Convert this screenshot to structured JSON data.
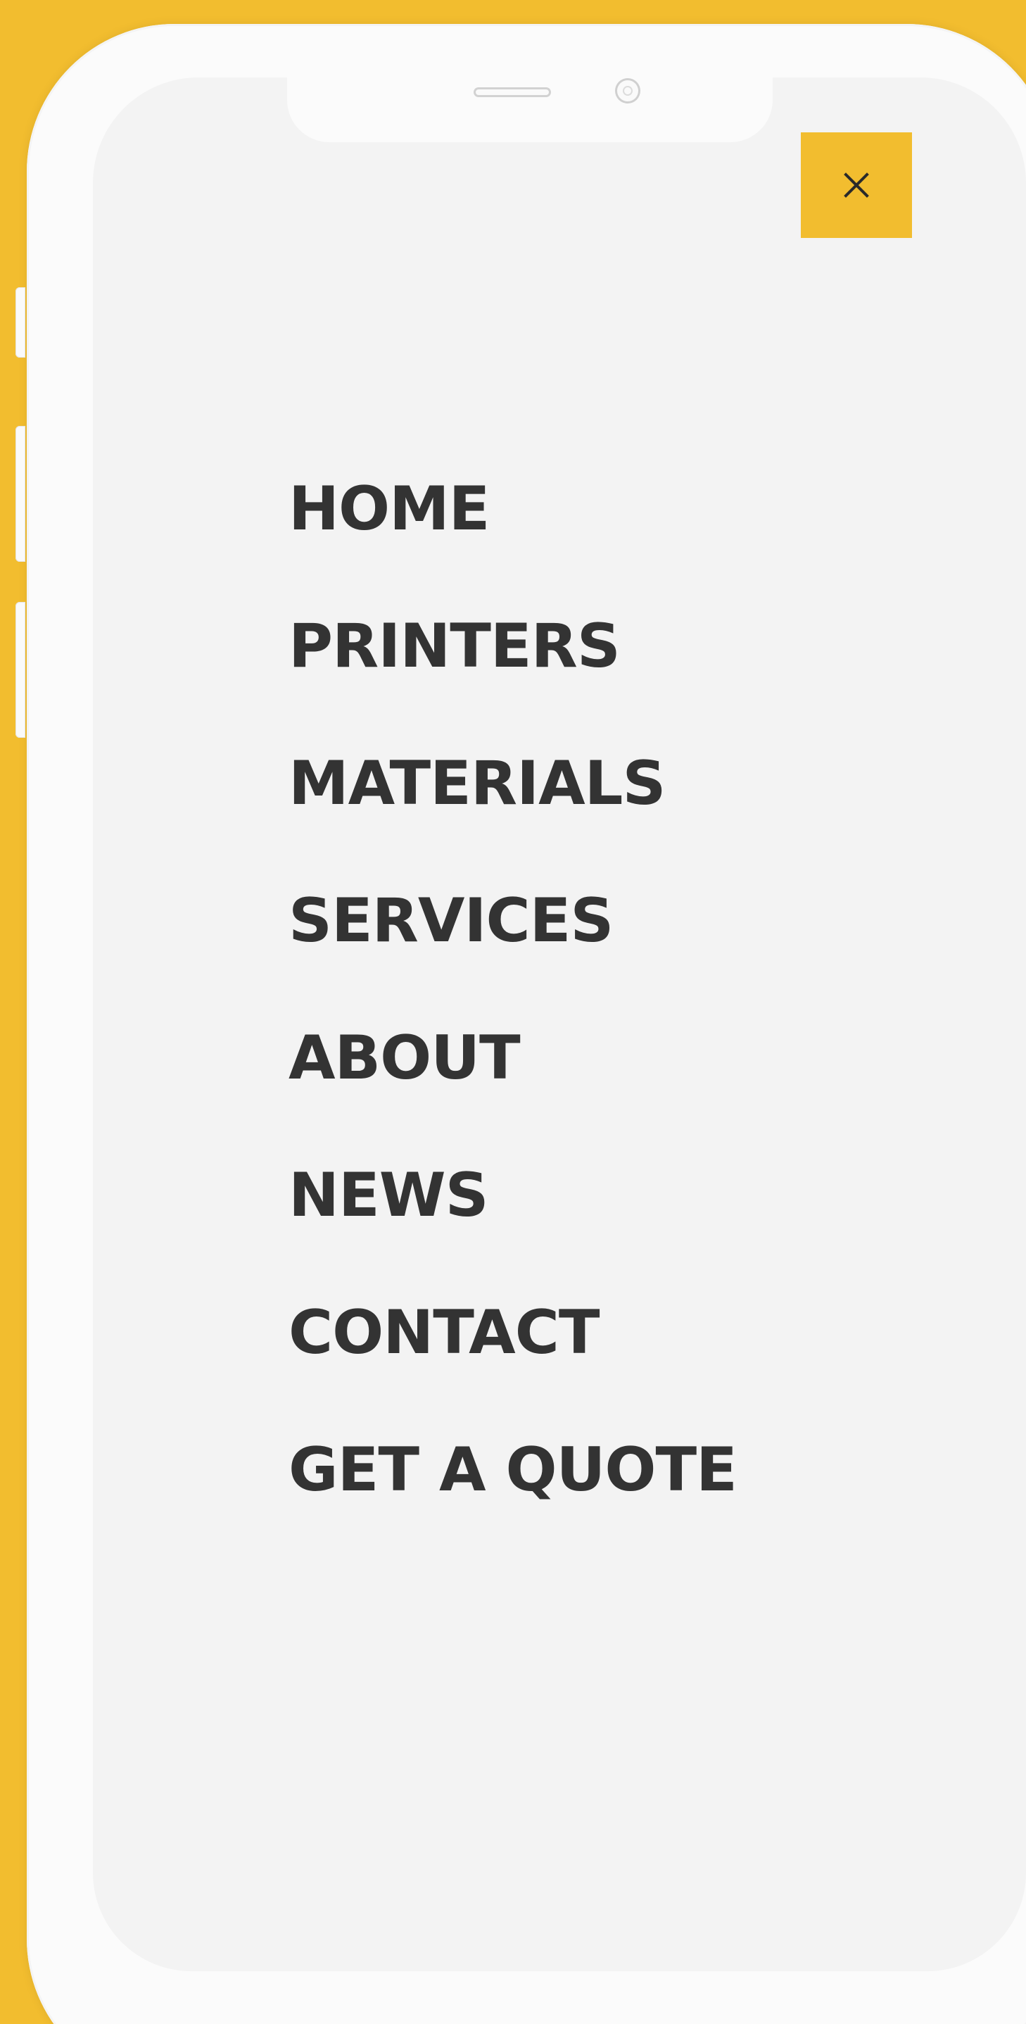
{
  "menu": {
    "items": [
      {
        "label": "HOME"
      },
      {
        "label": "PRINTERS"
      },
      {
        "label": "MATERIALS"
      },
      {
        "label": "SERVICES"
      },
      {
        "label": "ABOUT"
      },
      {
        "label": "NEWS"
      },
      {
        "label": "CONTACT"
      },
      {
        "label": "GET A QUOTE"
      }
    ],
    "close_icon": "close-icon"
  },
  "colors": {
    "accent": "#f2bd2f",
    "menu_text": "#333333",
    "screen_bg": "#f3f3f3",
    "frame": "#fbfbfb"
  }
}
